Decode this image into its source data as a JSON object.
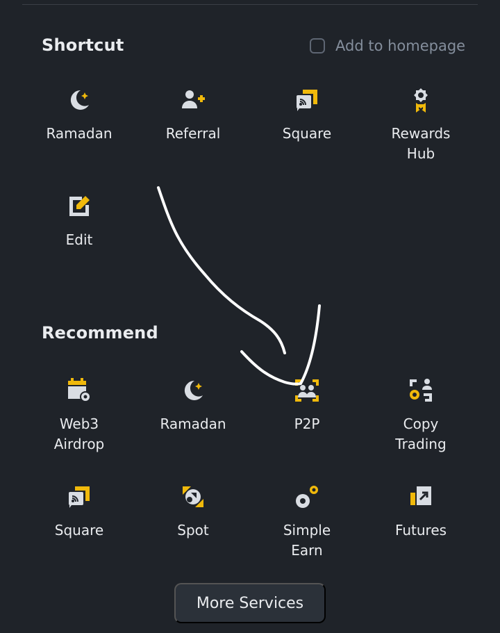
{
  "shortcut": {
    "title": "Shortcut",
    "add_to_homepage_label": "Add to homepage",
    "items": [
      {
        "label": "Ramadan",
        "icon": "crescent-moon-star-icon"
      },
      {
        "label": "Referral",
        "icon": "add-person-icon"
      },
      {
        "label": "Square",
        "icon": "square-cast-icon"
      },
      {
        "label": "Rewards\nHub",
        "icon": "reward-badge-icon"
      },
      {
        "label": "Edit",
        "icon": "edit-icon"
      }
    ]
  },
  "recommend": {
    "title": "Recommend",
    "items": [
      {
        "label": "Web3\nAirdrop",
        "icon": "calendar-airdrop-icon"
      },
      {
        "label": "Ramadan",
        "icon": "crescent-moon-star-icon"
      },
      {
        "label": "P2P",
        "icon": "p2p-people-icon"
      },
      {
        "label": "Copy\nTrading",
        "icon": "copy-trading-icon"
      },
      {
        "label": "Square",
        "icon": "square-cast-icon"
      },
      {
        "label": "Spot",
        "icon": "spot-icon"
      },
      {
        "label": "Simple\nEarn",
        "icon": "simple-earn-icon"
      },
      {
        "label": "Futures",
        "icon": "futures-icon"
      }
    ]
  },
  "more_services_label": "More Services",
  "colors": {
    "background": "#1f2329",
    "accent": "#f0b90b",
    "icon_gray": "#d9dde3",
    "text": "#eaecef",
    "muted": "#848e9c"
  }
}
